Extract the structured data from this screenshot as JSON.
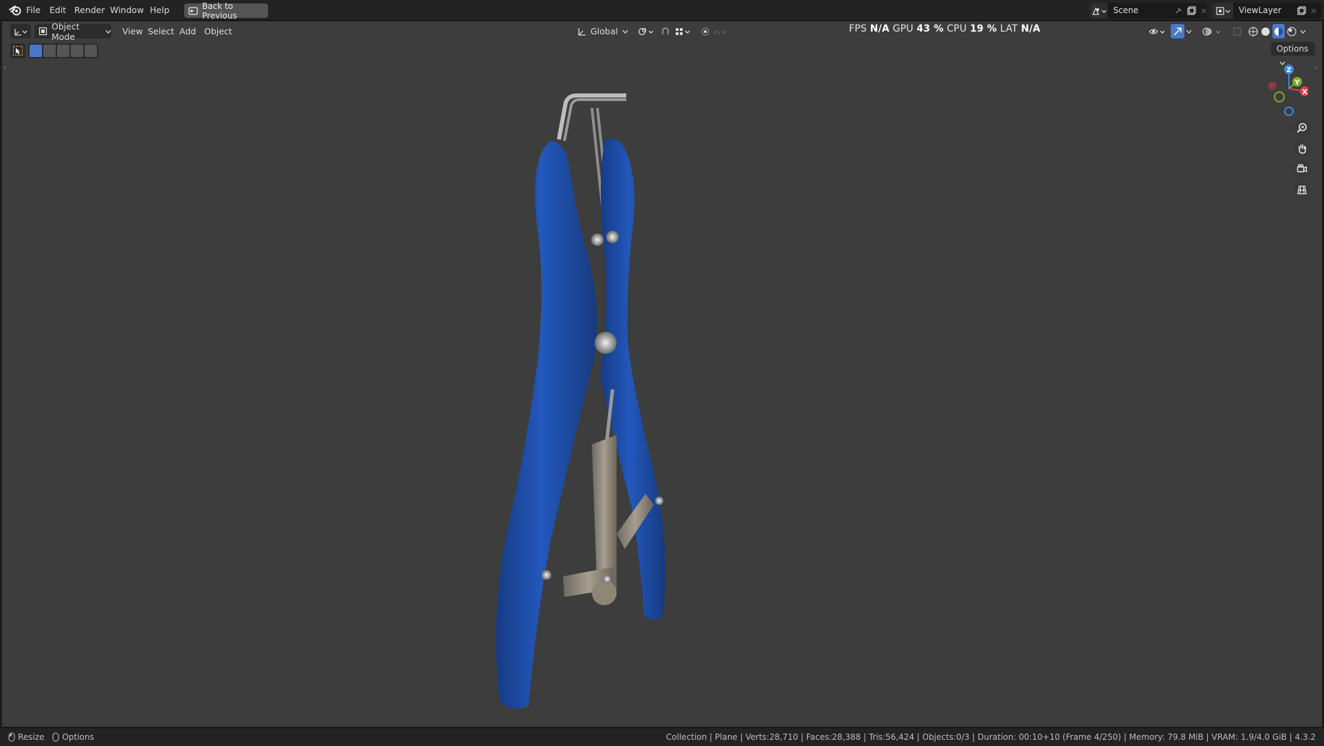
{
  "menubar": {
    "items": [
      "File",
      "Edit",
      "Render",
      "Window",
      "Help"
    ],
    "back_button": "Back to Previous",
    "scene_name": "Scene",
    "view_layer_name": "ViewLayer"
  },
  "viewport_header": {
    "mode": "Object Mode",
    "menus": [
      "View",
      "Select",
      "Add",
      "Object"
    ],
    "transform_orientation": "Global",
    "options_label": "Options"
  },
  "stats": {
    "fps_label": "FPS",
    "fps_value": "N/A",
    "gpu_label": "GPU",
    "gpu_value": "43 %",
    "cpu_label": "CPU",
    "cpu_value": "19 %",
    "lat_label": "LAT",
    "lat_value": "N/A"
  },
  "gizmo": {
    "z": "Z",
    "y": "Y",
    "x": "X"
  },
  "icons": {
    "navigation": [
      "zoom-icon",
      "pan-hand-icon",
      "camera-icon",
      "ortho-grid-icon"
    ],
    "shading": [
      "wireframe-icon",
      "solid-icon",
      "material-preview-icon",
      "rendered-icon"
    ]
  },
  "colors": {
    "accent_blue": "#4a78c8",
    "handle_blue": "#1f4fa8",
    "x_axis": "#e0404f",
    "y_axis": "#7aae28",
    "z_axis": "#3e86db"
  },
  "statusbar": {
    "resize_label": "Resize",
    "options_label": "Options",
    "info": "Collection | Plane | Verts:28,710 | Faces:28,388 | Tris:56,424 | Objects:0/3 | Duration: 00:10+10 (Frame 4/250) | Memory: 79.8 MiB | VRAM: 1.9/4.0 GiB | 4.3.2"
  }
}
